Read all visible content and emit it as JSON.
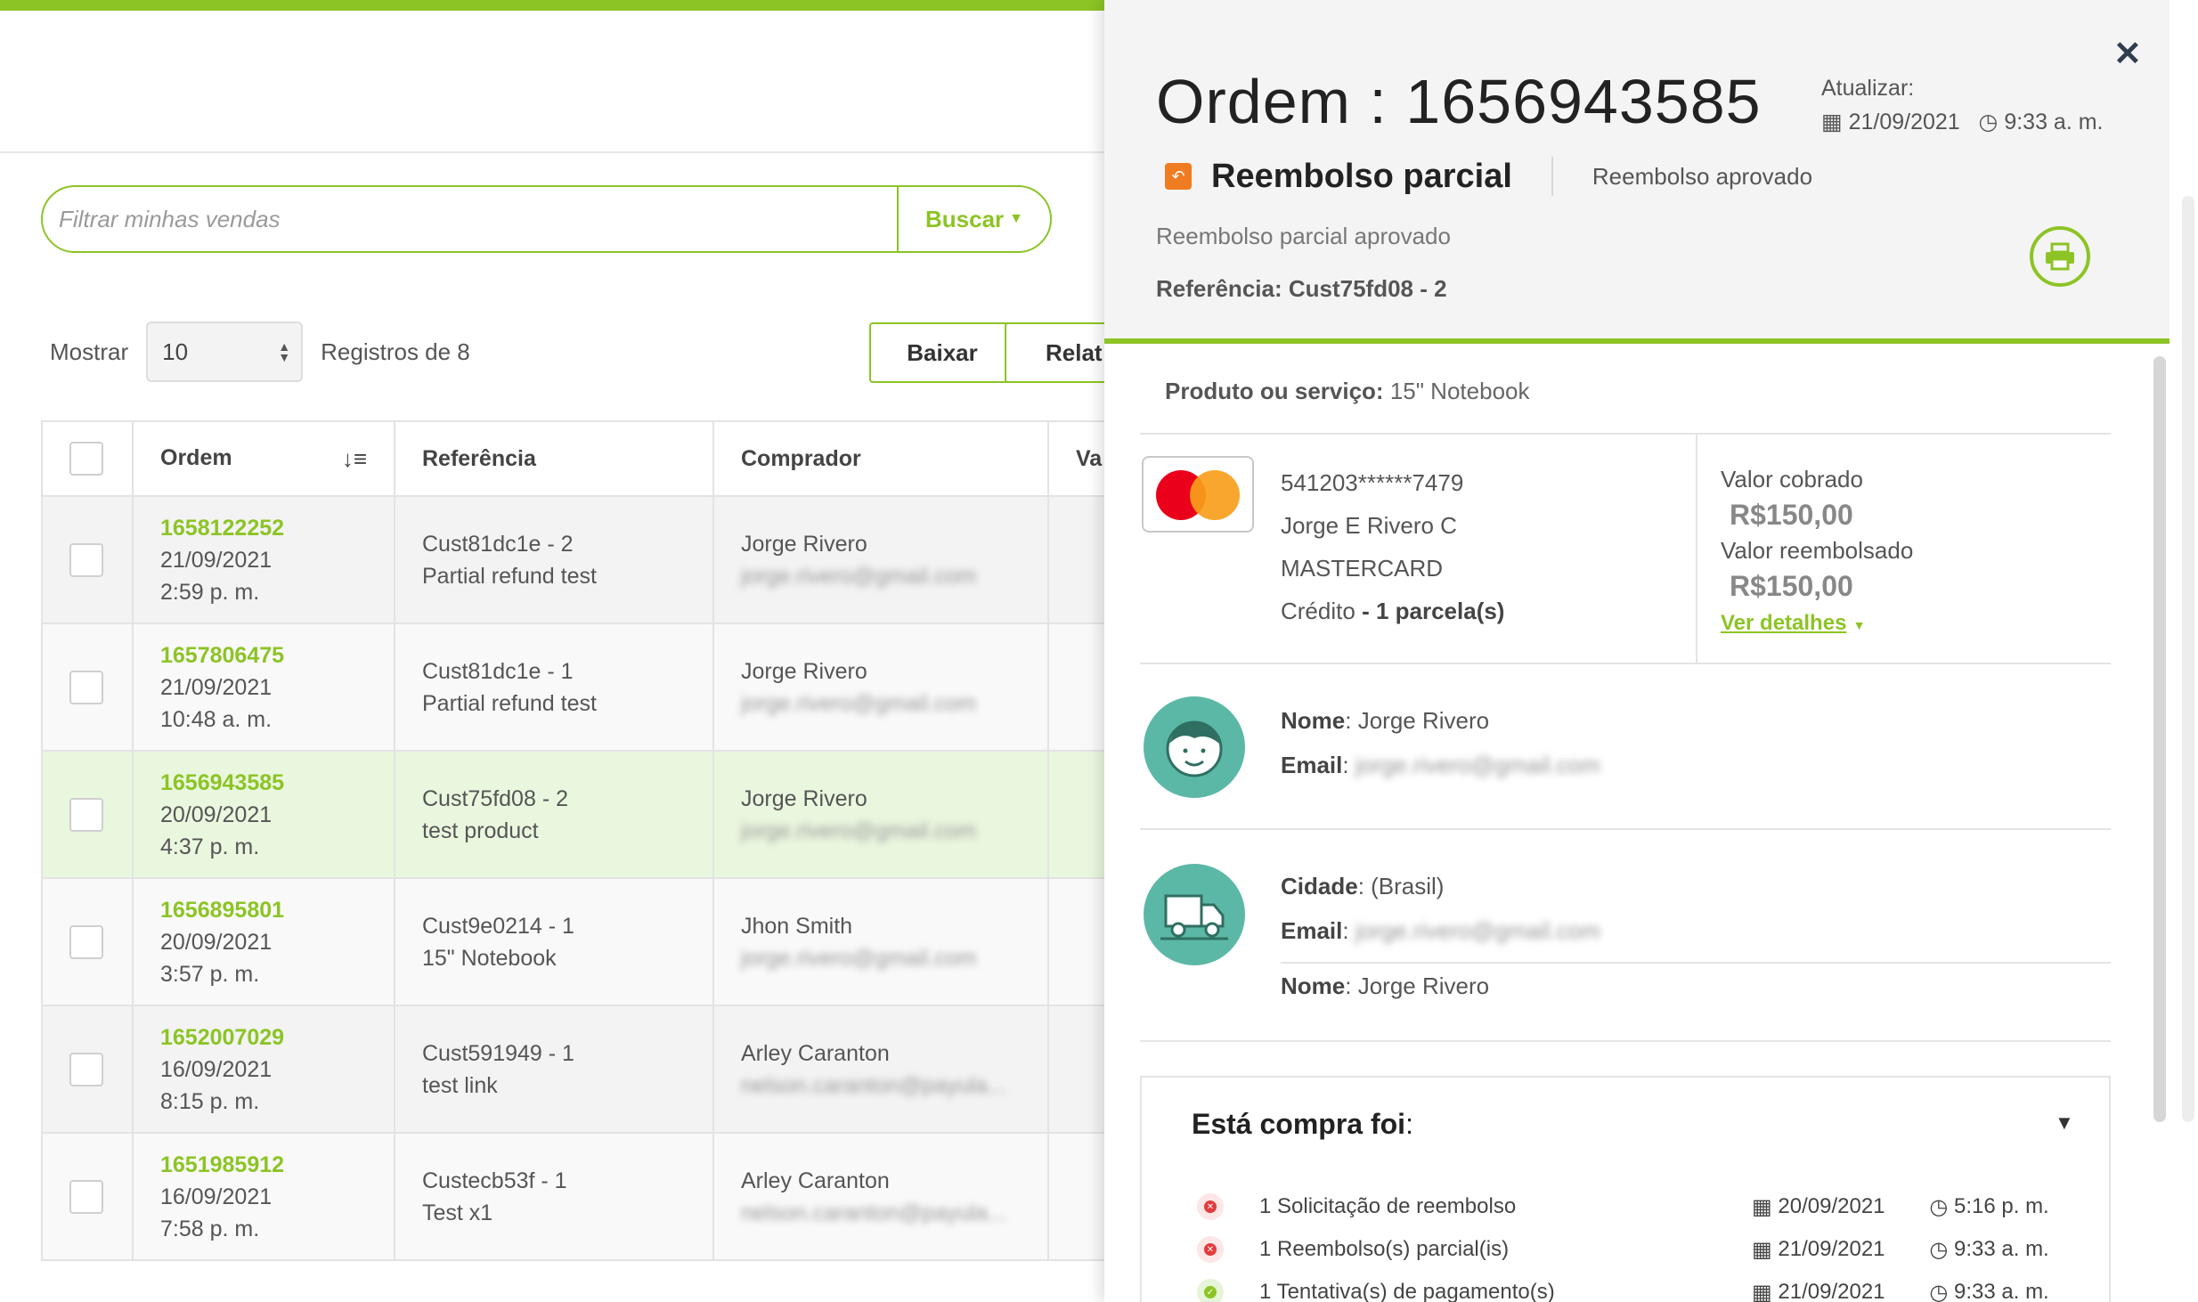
{
  "search": {
    "placeholder": "Filtrar minhas vendas",
    "button": "Buscar"
  },
  "controls": {
    "show_label": "Mostrar",
    "page_size": "10",
    "records_label": "Registros de 8",
    "download": "Baixar",
    "report": "Relat"
  },
  "table": {
    "headers": {
      "order": "Ordem",
      "reference": "Referência",
      "buyer": "Comprador",
      "value": "Va"
    },
    "rows": [
      {
        "order": "1658122252",
        "date": "21/09/2021",
        "time": "2:59 p. m.",
        "ref": "Cust81dc1e - 2",
        "desc": "Partial refund test",
        "buyer": "Jorge Rivero",
        "email": "jorge.rivero@gmail.com"
      },
      {
        "order": "1657806475",
        "date": "21/09/2021",
        "time": "10:48 a. m.",
        "ref": "Cust81dc1e - 1",
        "desc": "Partial refund test",
        "buyer": "Jorge Rivero",
        "email": "jorge.rivero@gmail.com"
      },
      {
        "order": "1656943585",
        "date": "20/09/2021",
        "time": "4:37 p. m.",
        "ref": "Cust75fd08 - 2",
        "desc": "test product",
        "buyer": "Jorge Rivero",
        "email": "jorge.rivero@gmail.com"
      },
      {
        "order": "1656895801",
        "date": "20/09/2021",
        "time": "3:57 p. m.",
        "ref": "Cust9e0214 - 1",
        "desc": "15\" Notebook",
        "buyer": "Jhon Smith",
        "email": "jorge.rivero@gmail.com"
      },
      {
        "order": "1652007029",
        "date": "16/09/2021",
        "time": "8:15 p. m.",
        "ref": "Cust591949 - 1",
        "desc": "test link",
        "buyer": "Arley Caranton",
        "email": "nelson.caranton@payula..."
      },
      {
        "order": "1651985912",
        "date": "16/09/2021",
        "time": "7:58 p. m.",
        "ref": "Custecb53f - 1",
        "desc": "Test x1",
        "buyer": "Arley Caranton",
        "email": "nelson.caranton@payula..."
      }
    ]
  },
  "panel": {
    "title": "Ordem : 1656943585",
    "update_label": "Atualizar:",
    "update_date": "21/09/2021",
    "update_time": "9:33 a. m.",
    "status": "Reembolso parcial",
    "status_detail": "Reembolso aprovado",
    "subtitle": "Reembolso parcial aprovado",
    "reference": "Referência: Cust75fd08 - 2",
    "product_label": "Produto ou serviço:",
    "product_value": "15\" Notebook",
    "card_number": "541203******7479",
    "card_holder": "Jorge E Rivero C",
    "card_brand": "MASTERCARD",
    "card_type": "Crédito",
    "installments": "- 1 parcela(s)",
    "charged_label": "Valor cobrado",
    "charged_value": "R$150,00",
    "refunded_label": "Valor reembolsado",
    "refunded_value": "R$150,00",
    "details_link": "Ver detalhes",
    "buyer_name_label": "Nome",
    "buyer_name": ": Jorge Rivero",
    "buyer_email_label": "Email",
    "buyer_email": "jorge.rivero@gmail.com",
    "city_label": "Cidade",
    "city_value": ": (Brasil)",
    "ship_email_label": "Email",
    "ship_email": "jorge.rivero@gmail.com",
    "ship_name_label": "Nome",
    "ship_name": ": Jorge Rivero",
    "history_title": "Está compra foi",
    "history_colon": ":",
    "events": [
      {
        "label": "1 Solicitação de reembolso",
        "date": "20/09/2021",
        "time": "5:16 p. m.",
        "status": "error"
      },
      {
        "label": "1 Reembolso(s) parcial(is)",
        "date": "21/09/2021",
        "time": "9:33 a. m.",
        "status": "error"
      },
      {
        "label": "1 Tentativa(s) de pagamento(s)",
        "date": "21/09/2021",
        "time": "9:33 a. m.",
        "status": "ok"
      }
    ]
  },
  "colors": {
    "accent": "#8cc425",
    "highlight_row": "#eaf7df",
    "avatar": "#5cb8a6",
    "status_icon": "#f07c22"
  }
}
